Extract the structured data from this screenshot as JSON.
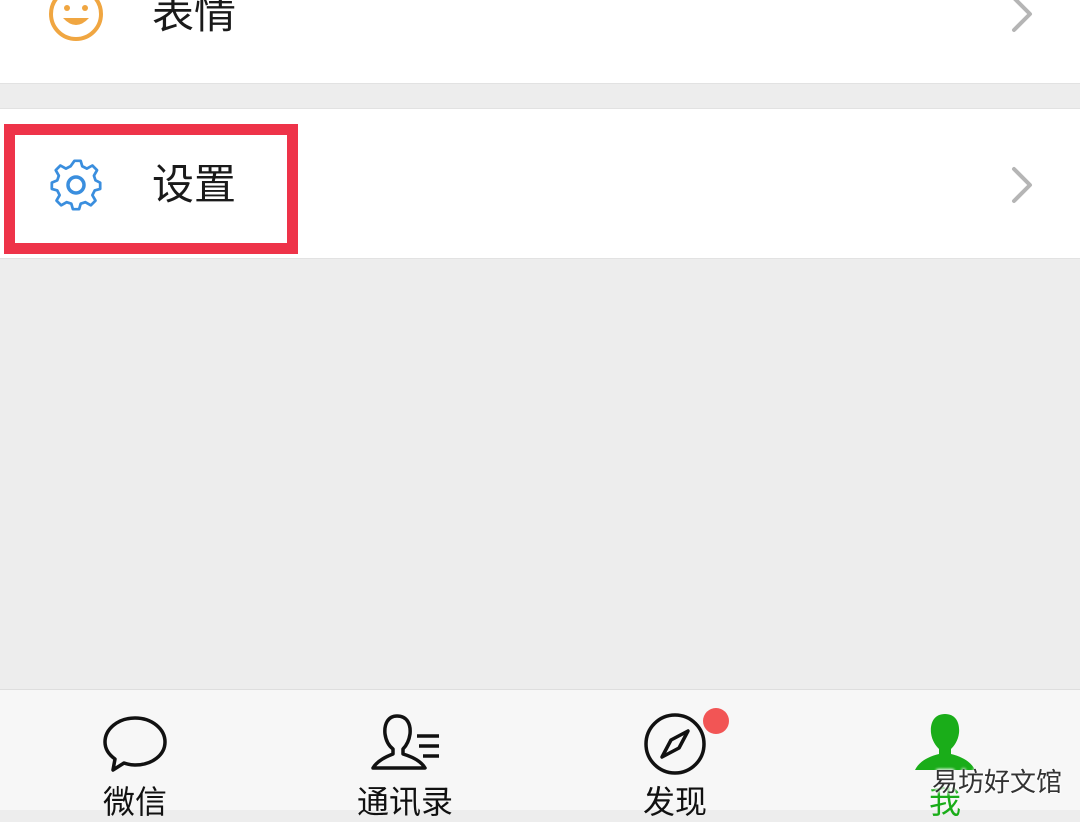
{
  "menu": {
    "stickers_label": "表情",
    "settings_label": "设置"
  },
  "tabbar": {
    "items": [
      {
        "label": "微信",
        "icon": "chat-bubble-icon"
      },
      {
        "label": "通讯录",
        "icon": "contacts-icon"
      },
      {
        "label": "发现",
        "icon": "compass-icon"
      },
      {
        "label": "我",
        "icon": "person-icon"
      }
    ],
    "active_color": "#1aad19",
    "badge_color": "#f25555"
  },
  "highlight_color": "#ee3349",
  "watermark": "易坊好文馆"
}
